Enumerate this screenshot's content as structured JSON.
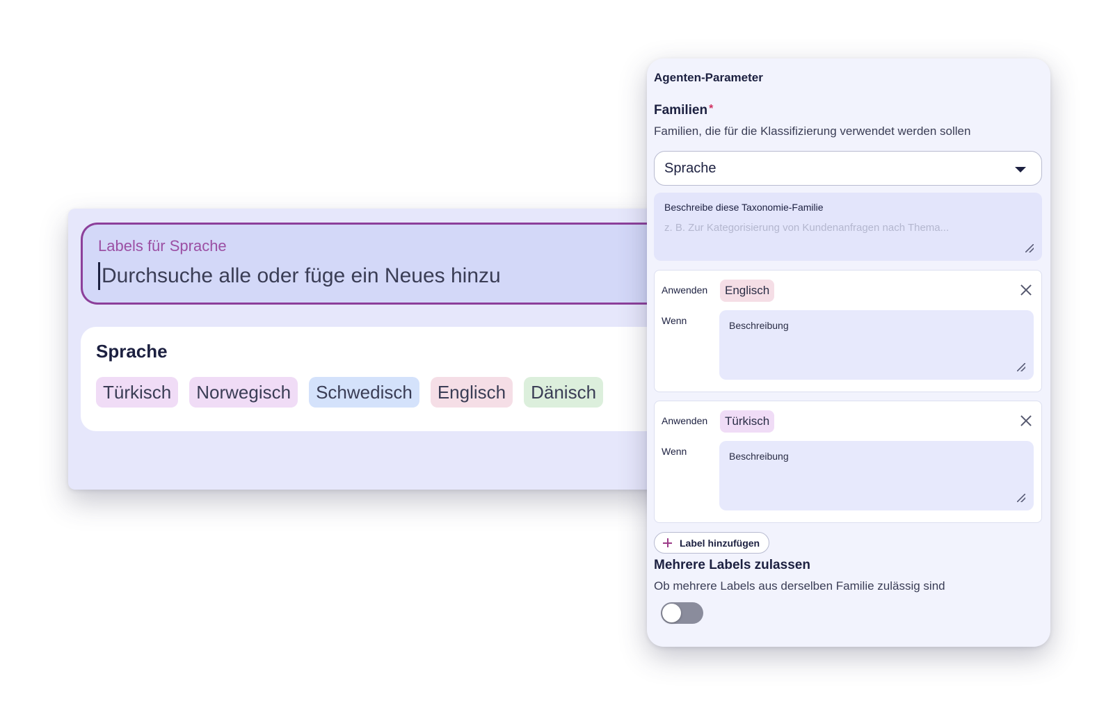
{
  "labels_panel": {
    "search_label": "Labels für Sprache",
    "search_placeholder": "Durchsuche alle oder füge ein Neues hinzu",
    "family_title": "Sprache",
    "chips": [
      {
        "label": "Türkisch",
        "color": "#f0dcf6"
      },
      {
        "label": "Norwegisch",
        "color": "#f0dcf6"
      },
      {
        "label": "Schwedisch",
        "color": "#d4e2fb"
      },
      {
        "label": "Englisch",
        "color": "#f5dee6"
      },
      {
        "label": "Dänisch",
        "color": "#dcefdc"
      }
    ]
  },
  "agent_params": {
    "title": "Agenten-Parameter",
    "families": {
      "label": "Familien",
      "required_mark": "*",
      "description": "Familien, die für die Klassifizierung verwendet werden sollen",
      "selected": "Sprache",
      "describe_label": "Beschreibe diese Taxonomie-Familie",
      "describe_placeholder": "z. B. Zur Kategorisierung von Kundenanfragen nach Thema..."
    },
    "rules": [
      {
        "apply_label": "Anwenden",
        "chip": "Englisch",
        "chip_color": "#f5dee6",
        "when_label": "Wenn",
        "when_placeholder": "Beschreibung"
      },
      {
        "apply_label": "Anwenden",
        "chip": "Türkisch",
        "chip_color": "#f0dcf6",
        "when_label": "Wenn",
        "when_placeholder": "Beschreibung"
      }
    ],
    "add_label_button": "Label hinzufügen",
    "multiple": {
      "title": "Mehrere Labels zulassen",
      "description": "Ob mehrere Labels aus derselben Familie zulässig sind",
      "enabled": false
    }
  },
  "colors": {
    "accent": "#8c3f9a",
    "required": "#d03060",
    "toggle_off": "#8a8c9c"
  }
}
